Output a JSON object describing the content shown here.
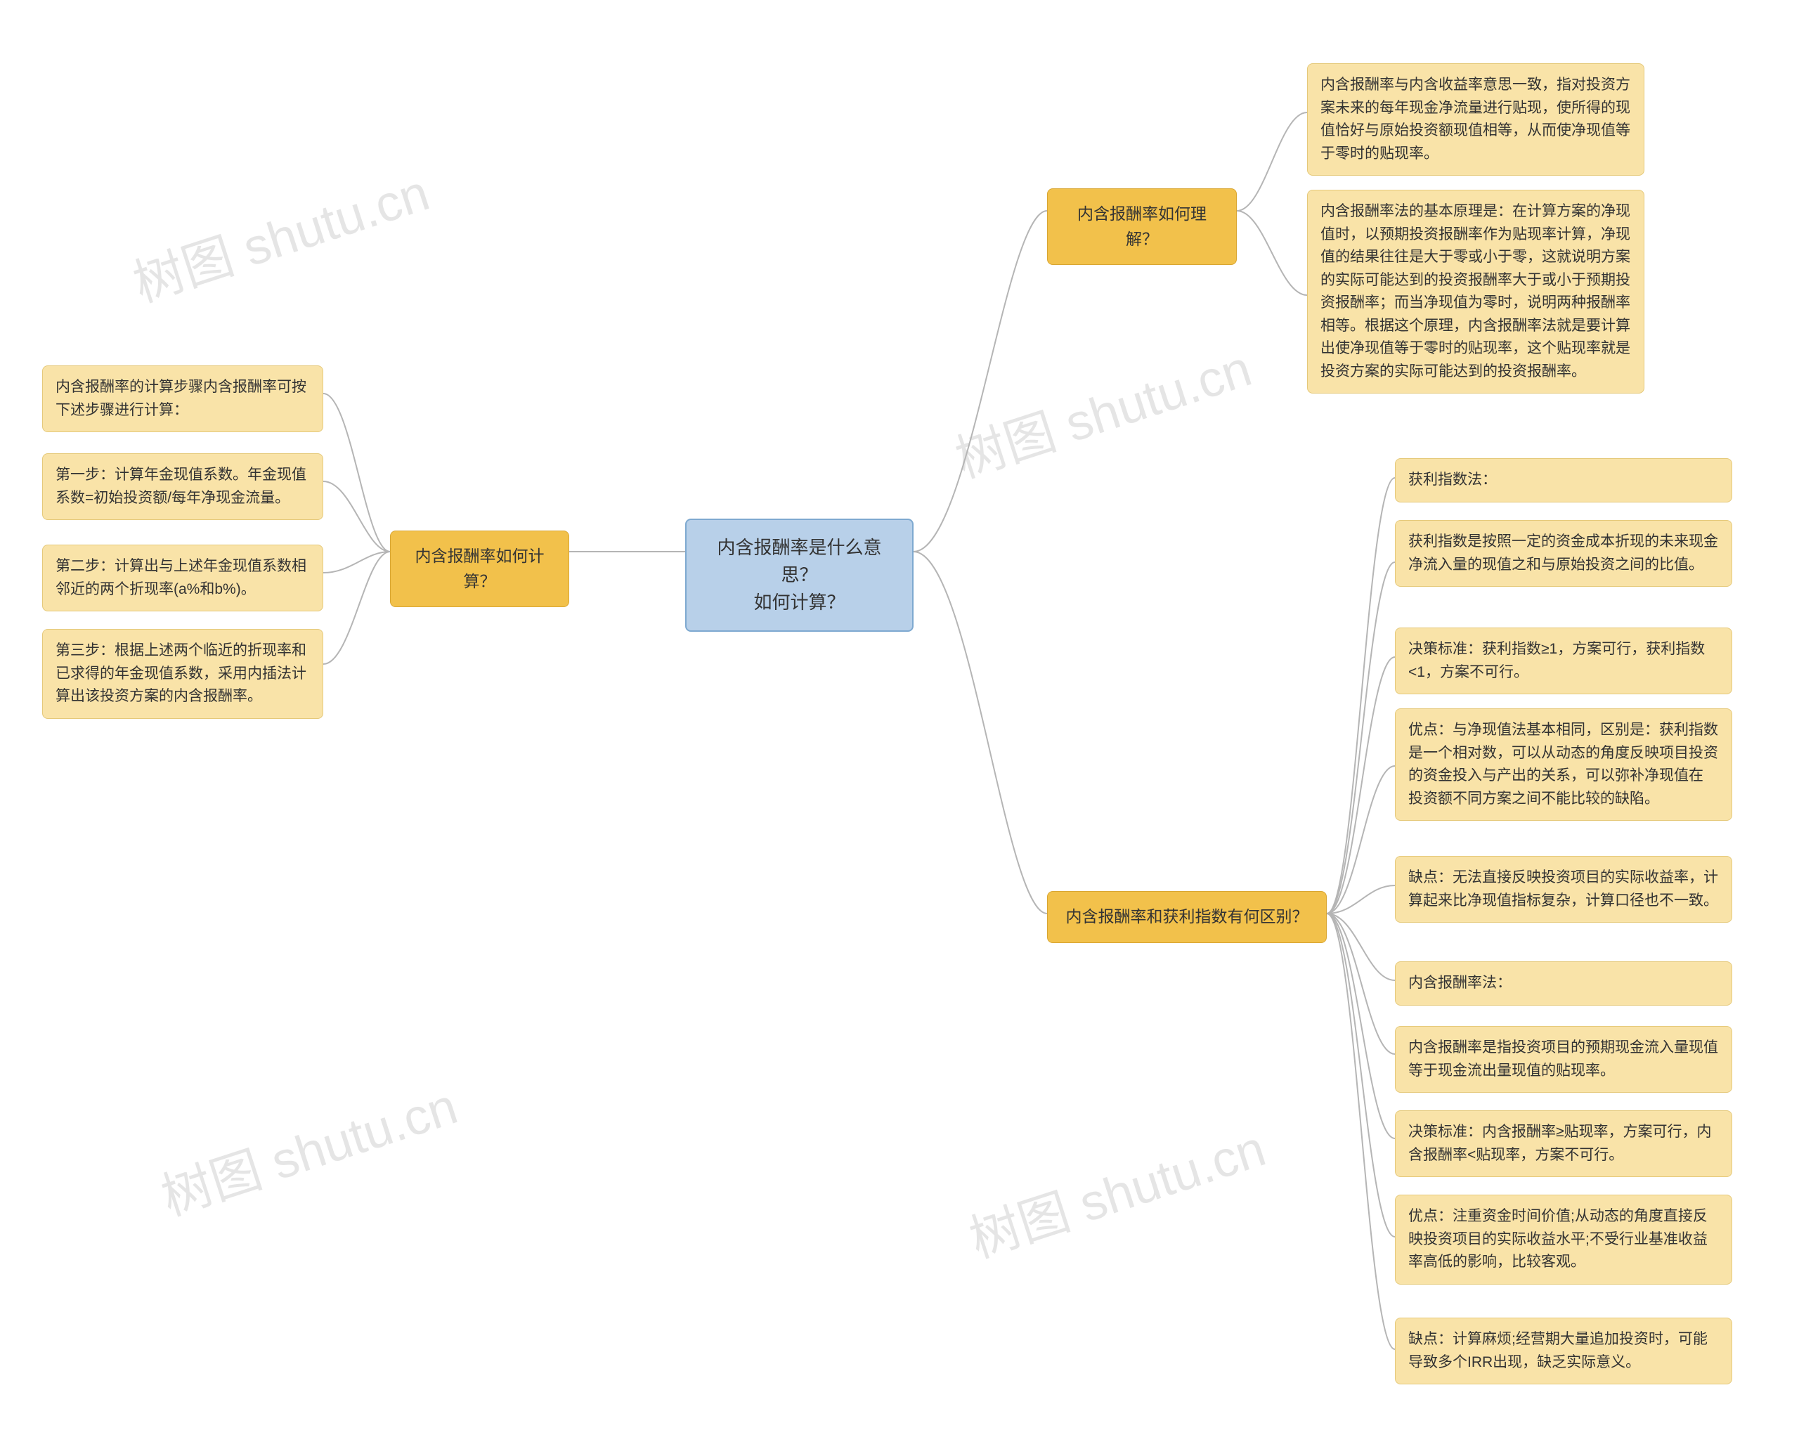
{
  "root": {
    "line1": "内含报酬率是什么意思？",
    "line2": "如何计算？"
  },
  "left": {
    "branch": "内含报酬率如何计算？",
    "leaves": [
      "内含报酬率的计算步骤内含报酬率可按下述步骤进行计算：",
      "第一步：计算年金现值系数。年金现值系数=初始投资额/每年净现金流量。",
      "第二步：计算出与上述年金现值系数相邻近的两个折现率(a%和b%)。",
      "第三步：根据上述两个临近的折现率和已求得的年金现值系数，采用内插法计算出该投资方案的内含报酬率。"
    ]
  },
  "right1": {
    "branch": "内含报酬率如何理解？",
    "leaves": [
      "内含报酬率与内含收益率意思一致，指对投资方案未来的每年现金净流量进行贴现，使所得的现值恰好与原始投资额现值相等，从而使净现值等于零时的贴现率。",
      "内含报酬率法的基本原理是：在计算方案的净现值时，以预期投资报酬率作为贴现率计算，净现值的结果往往是大于零或小于零，这就说明方案的实际可能达到的投资报酬率大于或小于预期投资报酬率；而当净现值为零时，说明两种报酬率相等。根据这个原理，内含报酬率法就是要计算出使净现值等于零时的贴现率，这个贴现率就是投资方案的实际可能达到的投资报酬率。"
    ]
  },
  "right2": {
    "branch": "内含报酬率和获利指数有何区别？",
    "leaves": [
      "获利指数法：",
      "获利指数是按照一定的资金成本折现的未来现金净流入量的现值之和与原始投资之间的比值。",
      "决策标准：获利指数≥1，方案可行，获利指数<1，方案不可行。",
      "优点：与净现值法基本相同，区别是：获利指数是一个相对数，可以从动态的角度反映项目投资的资金投入与产出的关系，可以弥补净现值在\n投资额不同方案之间不能比较的缺陷。",
      "缺点：无法直接反映投资项目的实际收益率，计算起来比净现值指标复杂，计算口径也不一致。",
      "内含报酬率法：",
      "内含报酬率是指投资项目的预期现金流入量现值等于现金流出量现值的贴现率。",
      "决策标准：内含报酬率≥贴现率，方案可行，内含报酬率<贴现率，方案不可行。",
      "优点：注重资金时间价值;从动态的角度直接反映投资项目的实际收益水平;不受行业基准收益率高低的影响，比较客观。",
      "缺点：计算麻烦;经营期大量追加投资时，可能导致多个IRR出现，缺乏实际意义。"
    ]
  },
  "watermark": "树图 shutu.cn",
  "chart_data": {
    "type": "mindmap",
    "title": "内含报酬率是什么意思？如何计算？",
    "root": "内含报酬率是什么意思？如何计算？",
    "branches": [
      {
        "side": "left",
        "label": "内含报酬率如何计算？",
        "children": [
          "内含报酬率的计算步骤内含报酬率可按下述步骤进行计算：",
          "第一步：计算年金现值系数。年金现值系数=初始投资额/每年净现金流量。",
          "第二步：计算出与上述年金现值系数相邻近的两个折现率(a%和b%)。",
          "第三步：根据上述两个临近的折现率和已求得的年金现值系数，采用内插法计算出该投资方案的内含报酬率。"
        ]
      },
      {
        "side": "right",
        "label": "内含报酬率如何理解？",
        "children": [
          "内含报酬率与内含收益率意思一致，指对投资方案未来的每年现金净流量进行贴现，使所得的现值恰好与原始投资额现值相等，从而使净现值等于零时的贴现率。",
          "内含报酬率法的基本原理是：在计算方案的净现值时，以预期投资报酬率作为贴现率计算，净现值的结果往往是大于零或小于零，这就说明方案的实际可能达到的投资报酬率大于或小于预期投资报酬率；而当净现值为零时，说明两种报酬率相等。根据这个原理，内含报酬率法就是要计算出使净现值等于零时的贴现率，这个贴现率就是投资方案的实际可能达到的投资报酬率。"
        ]
      },
      {
        "side": "right",
        "label": "内含报酬率和获利指数有何区别？",
        "children": [
          "获利指数法：",
          "获利指数是按照一定的资金成本折现的未来现金净流入量的现值之和与原始投资之间的比值。",
          "决策标准：获利指数≥1，方案可行，获利指数<1，方案不可行。",
          "优点：与净现值法基本相同，区别是：获利指数是一个相对数，可以从动态的角度反映项目投资的资金投入与产出的关系，可以弥补净现值在投资额不同方案之间不能比较的缺陷。",
          "缺点：无法直接反映投资项目的实际收益率，计算起来比净现值指标复杂，计算口径也不一致。",
          "内含报酬率法：",
          "内含报酬率是指投资项目的预期现金流入量现值等于现金流出量现值的贴现率。",
          "决策标准：内含报酬率≥贴现率，方案可行，内含报酬率<贴现率，方案不可行。",
          "优点：注重资金时间价值;从动态的角度直接反映投资项目的实际收益水平;不受行业基准收益率高低的影响，比较客观。",
          "缺点：计算麻烦;经营期大量追加投资时，可能导致多个IRR出现，缺乏实际意义。"
        ]
      }
    ]
  }
}
